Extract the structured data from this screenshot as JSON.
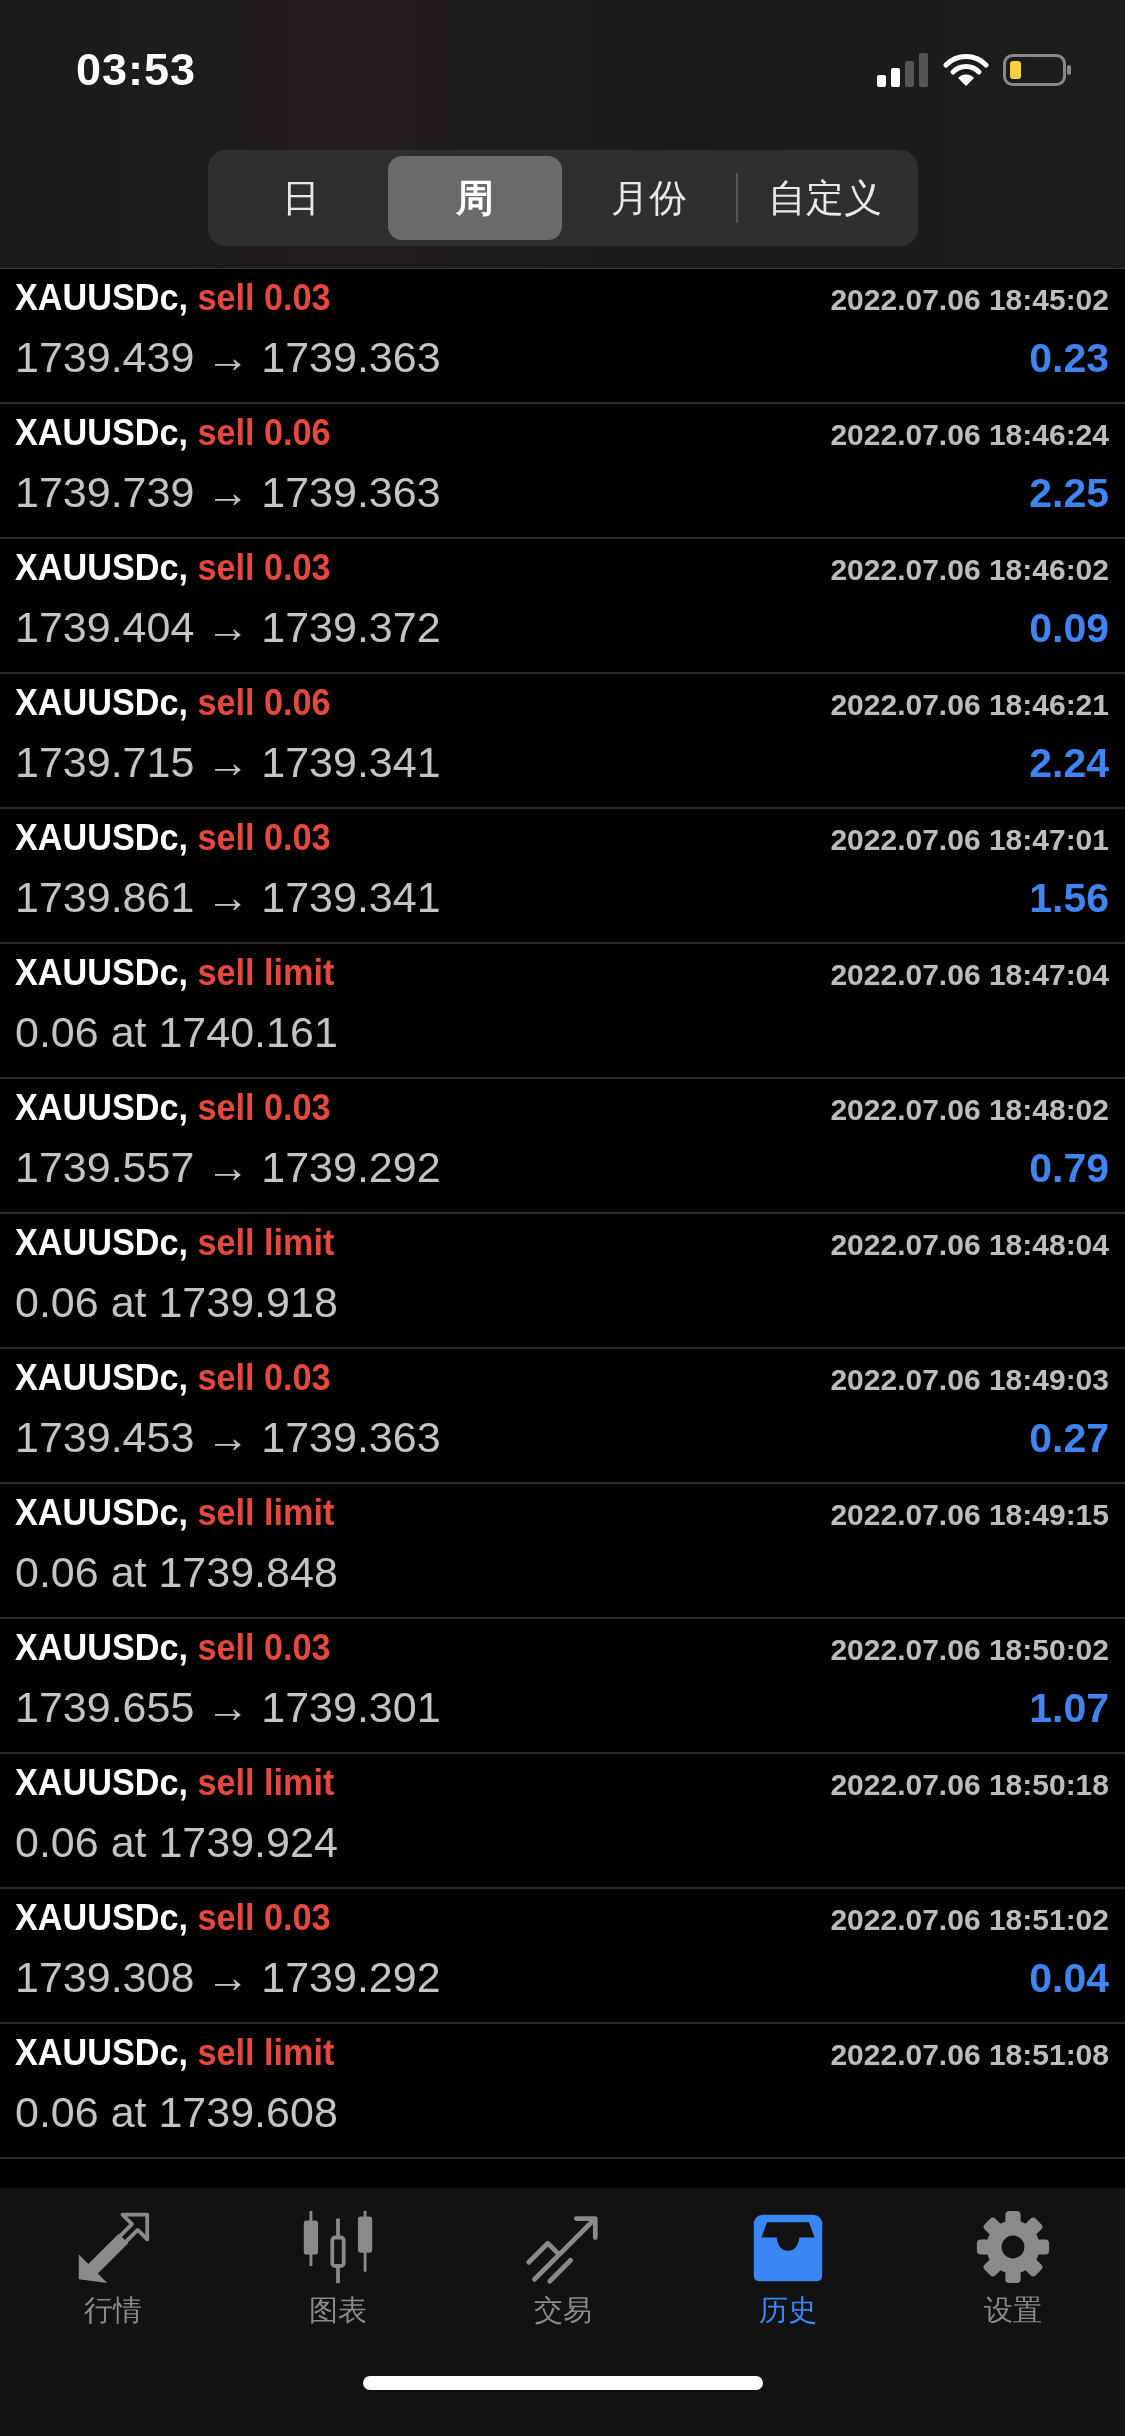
{
  "status_bar": {
    "time": "03:53"
  },
  "segments": [
    {
      "label": "日",
      "selected": false
    },
    {
      "label": "周",
      "selected": true
    },
    {
      "label": "月份",
      "selected": false
    },
    {
      "label": "自定义",
      "selected": false
    }
  ],
  "history": [
    {
      "symbol": "XAUUSDc,",
      "action": "sell 0.03",
      "time": "2022.07.06 18:45:02",
      "detail": "1739.439 → 1739.363",
      "profit": "0.23"
    },
    {
      "symbol": "XAUUSDc,",
      "action": "sell 0.06",
      "time": "2022.07.06 18:46:24",
      "detail": "1739.739 → 1739.363",
      "profit": "2.25"
    },
    {
      "symbol": "XAUUSDc,",
      "action": "sell 0.03",
      "time": "2022.07.06 18:46:02",
      "detail": "1739.404 → 1739.372",
      "profit": "0.09"
    },
    {
      "symbol": "XAUUSDc,",
      "action": "sell 0.06",
      "time": "2022.07.06 18:46:21",
      "detail": "1739.715 → 1739.341",
      "profit": "2.24"
    },
    {
      "symbol": "XAUUSDc,",
      "action": "sell 0.03",
      "time": "2022.07.06 18:47:01",
      "detail": "1739.861 → 1739.341",
      "profit": "1.56"
    },
    {
      "symbol": "XAUUSDc,",
      "action": "sell limit",
      "time": "2022.07.06 18:47:04",
      "detail": "0.06 at 1740.161"
    },
    {
      "symbol": "XAUUSDc,",
      "action": "sell 0.03",
      "time": "2022.07.06 18:48:02",
      "detail": "1739.557 → 1739.292",
      "profit": "0.79"
    },
    {
      "symbol": "XAUUSDc,",
      "action": "sell limit",
      "time": "2022.07.06 18:48:04",
      "detail": "0.06 at 1739.918"
    },
    {
      "symbol": "XAUUSDc,",
      "action": "sell 0.03",
      "time": "2022.07.06 18:49:03",
      "detail": "1739.453 → 1739.363",
      "profit": "0.27"
    },
    {
      "symbol": "XAUUSDc,",
      "action": "sell limit",
      "time": "2022.07.06 18:49:15",
      "detail": "0.06 at 1739.848"
    },
    {
      "symbol": "XAUUSDc,",
      "action": "sell 0.03",
      "time": "2022.07.06 18:50:02",
      "detail": "1739.655 → 1739.301",
      "profit": "1.07"
    },
    {
      "symbol": "XAUUSDc,",
      "action": "sell limit",
      "time": "2022.07.06 18:50:18",
      "detail": "0.06 at 1739.924"
    },
    {
      "symbol": "XAUUSDc,",
      "action": "sell 0.03",
      "time": "2022.07.06 18:51:02",
      "detail": "1739.308 → 1739.292",
      "profit": "0.04"
    },
    {
      "symbol": "XAUUSDc,",
      "action": "sell limit",
      "time": "2022.07.06 18:51:08",
      "detail": "0.06 at 1739.608"
    }
  ],
  "tab_bar": [
    {
      "label": "行情",
      "selected": false
    },
    {
      "label": "图表",
      "selected": false
    },
    {
      "label": "交易",
      "selected": false
    },
    {
      "label": "历史",
      "selected": true
    },
    {
      "label": "设置",
      "selected": false
    }
  ]
}
